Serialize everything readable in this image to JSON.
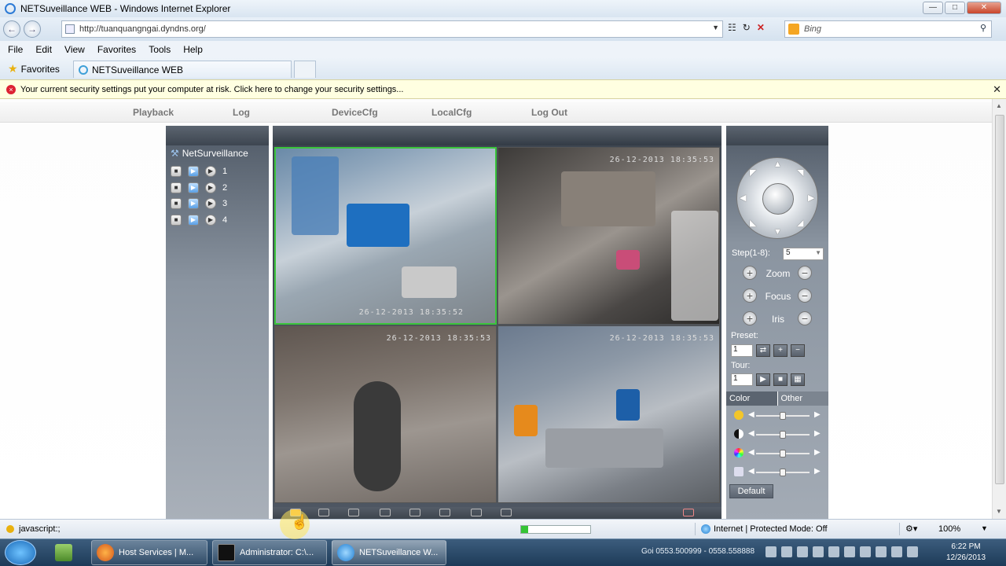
{
  "window": {
    "title": "NETSuveillance WEB - Windows Internet Explorer"
  },
  "address": {
    "url": "http://tuanquangngai.dyndns.org/"
  },
  "search": {
    "placeholder": "Bing"
  },
  "menu": [
    "File",
    "Edit",
    "View",
    "Favorites",
    "Tools",
    "Help"
  ],
  "favorites": {
    "label": "Favorites"
  },
  "tab": {
    "title": "NETSuveillance WEB"
  },
  "infobar": {
    "text": "Your current security settings put your computer at risk. Click here to change your security settings..."
  },
  "topnav": [
    "Playback",
    "Log",
    "DeviceCfg",
    "LocalCfg",
    "Log Out"
  ],
  "tree": {
    "root": "NetSurveillance",
    "channels": [
      "1",
      "2",
      "3",
      "4"
    ]
  },
  "cameras": [
    {
      "timestamp": "26-12-2013 18:35:52",
      "selected": true
    },
    {
      "timestamp": "26-12-2013 18:35:53",
      "selected": false
    },
    {
      "timestamp": "26-12-2013 18:35:53",
      "selected": false
    },
    {
      "timestamp": "26-12-2013 18:35:53",
      "selected": false
    }
  ],
  "ptz": {
    "step_label": "Step(1-8):",
    "step_value": "5",
    "zoom": "Zoom",
    "focus": "Focus",
    "iris": "Iris",
    "preset_label": "Preset:",
    "preset_value": "1",
    "tour_label": "Tour:",
    "tour_value": "1"
  },
  "color_tabs": {
    "color": "Color",
    "other": "Other"
  },
  "default_btn": "Default",
  "status": {
    "left": "javascript:;",
    "zone": "Internet | Protected Mode: Off",
    "zoom": "100%",
    "progress": 0.1
  },
  "taskbar": {
    "items": [
      "Host Services | M...",
      "Administrator: C:\\...",
      "NETSuveillance W..."
    ],
    "tray_text": "Goi 0553.500999 - 0558.558888",
    "time": "6:22 PM",
    "date": "12/26/2013"
  },
  "colors": {
    "accent": "#3bc43b",
    "panel": "#5c6570"
  }
}
